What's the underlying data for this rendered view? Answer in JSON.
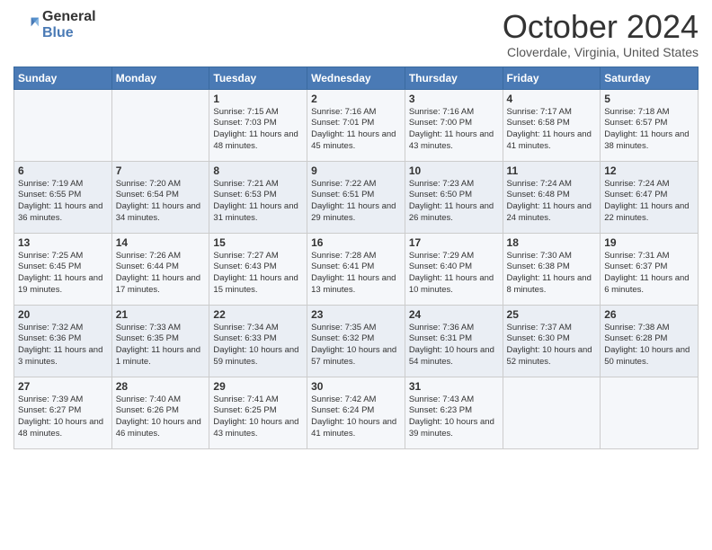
{
  "header": {
    "logo": {
      "general": "General",
      "blue": "Blue"
    },
    "title": "October 2024",
    "location": "Cloverdale, Virginia, United States"
  },
  "weekdays": [
    "Sunday",
    "Monday",
    "Tuesday",
    "Wednesday",
    "Thursday",
    "Friday",
    "Saturday"
  ],
  "weeks": [
    [
      {
        "day": null,
        "info": null
      },
      {
        "day": null,
        "info": null
      },
      {
        "day": "1",
        "info": "Sunrise: 7:15 AM\nSunset: 7:03 PM\nDaylight: 11 hours and 48 minutes."
      },
      {
        "day": "2",
        "info": "Sunrise: 7:16 AM\nSunset: 7:01 PM\nDaylight: 11 hours and 45 minutes."
      },
      {
        "day": "3",
        "info": "Sunrise: 7:16 AM\nSunset: 7:00 PM\nDaylight: 11 hours and 43 minutes."
      },
      {
        "day": "4",
        "info": "Sunrise: 7:17 AM\nSunset: 6:58 PM\nDaylight: 11 hours and 41 minutes."
      },
      {
        "day": "5",
        "info": "Sunrise: 7:18 AM\nSunset: 6:57 PM\nDaylight: 11 hours and 38 minutes."
      }
    ],
    [
      {
        "day": "6",
        "info": "Sunrise: 7:19 AM\nSunset: 6:55 PM\nDaylight: 11 hours and 36 minutes."
      },
      {
        "day": "7",
        "info": "Sunrise: 7:20 AM\nSunset: 6:54 PM\nDaylight: 11 hours and 34 minutes."
      },
      {
        "day": "8",
        "info": "Sunrise: 7:21 AM\nSunset: 6:53 PM\nDaylight: 11 hours and 31 minutes."
      },
      {
        "day": "9",
        "info": "Sunrise: 7:22 AM\nSunset: 6:51 PM\nDaylight: 11 hours and 29 minutes."
      },
      {
        "day": "10",
        "info": "Sunrise: 7:23 AM\nSunset: 6:50 PM\nDaylight: 11 hours and 26 minutes."
      },
      {
        "day": "11",
        "info": "Sunrise: 7:24 AM\nSunset: 6:48 PM\nDaylight: 11 hours and 24 minutes."
      },
      {
        "day": "12",
        "info": "Sunrise: 7:24 AM\nSunset: 6:47 PM\nDaylight: 11 hours and 22 minutes."
      }
    ],
    [
      {
        "day": "13",
        "info": "Sunrise: 7:25 AM\nSunset: 6:45 PM\nDaylight: 11 hours and 19 minutes."
      },
      {
        "day": "14",
        "info": "Sunrise: 7:26 AM\nSunset: 6:44 PM\nDaylight: 11 hours and 17 minutes."
      },
      {
        "day": "15",
        "info": "Sunrise: 7:27 AM\nSunset: 6:43 PM\nDaylight: 11 hours and 15 minutes."
      },
      {
        "day": "16",
        "info": "Sunrise: 7:28 AM\nSunset: 6:41 PM\nDaylight: 11 hours and 13 minutes."
      },
      {
        "day": "17",
        "info": "Sunrise: 7:29 AM\nSunset: 6:40 PM\nDaylight: 11 hours and 10 minutes."
      },
      {
        "day": "18",
        "info": "Sunrise: 7:30 AM\nSunset: 6:38 PM\nDaylight: 11 hours and 8 minutes."
      },
      {
        "day": "19",
        "info": "Sunrise: 7:31 AM\nSunset: 6:37 PM\nDaylight: 11 hours and 6 minutes."
      }
    ],
    [
      {
        "day": "20",
        "info": "Sunrise: 7:32 AM\nSunset: 6:36 PM\nDaylight: 11 hours and 3 minutes."
      },
      {
        "day": "21",
        "info": "Sunrise: 7:33 AM\nSunset: 6:35 PM\nDaylight: 11 hours and 1 minute."
      },
      {
        "day": "22",
        "info": "Sunrise: 7:34 AM\nSunset: 6:33 PM\nDaylight: 10 hours and 59 minutes."
      },
      {
        "day": "23",
        "info": "Sunrise: 7:35 AM\nSunset: 6:32 PM\nDaylight: 10 hours and 57 minutes."
      },
      {
        "day": "24",
        "info": "Sunrise: 7:36 AM\nSunset: 6:31 PM\nDaylight: 10 hours and 54 minutes."
      },
      {
        "day": "25",
        "info": "Sunrise: 7:37 AM\nSunset: 6:30 PM\nDaylight: 10 hours and 52 minutes."
      },
      {
        "day": "26",
        "info": "Sunrise: 7:38 AM\nSunset: 6:28 PM\nDaylight: 10 hours and 50 minutes."
      }
    ],
    [
      {
        "day": "27",
        "info": "Sunrise: 7:39 AM\nSunset: 6:27 PM\nDaylight: 10 hours and 48 minutes."
      },
      {
        "day": "28",
        "info": "Sunrise: 7:40 AM\nSunset: 6:26 PM\nDaylight: 10 hours and 46 minutes."
      },
      {
        "day": "29",
        "info": "Sunrise: 7:41 AM\nSunset: 6:25 PM\nDaylight: 10 hours and 43 minutes."
      },
      {
        "day": "30",
        "info": "Sunrise: 7:42 AM\nSunset: 6:24 PM\nDaylight: 10 hours and 41 minutes."
      },
      {
        "day": "31",
        "info": "Sunrise: 7:43 AM\nSunset: 6:23 PM\nDaylight: 10 hours and 39 minutes."
      },
      {
        "day": null,
        "info": null
      },
      {
        "day": null,
        "info": null
      }
    ]
  ]
}
